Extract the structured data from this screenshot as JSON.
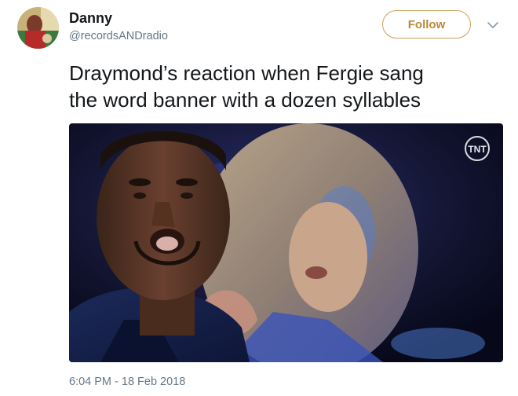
{
  "user": {
    "display_name": "Danny",
    "username": "@recordsANDradio"
  },
  "follow_button": {
    "label": "Follow"
  },
  "tweet": {
    "text": "Draymond’s reaction when Fergie sang\nthe word banner with a dozen syllables",
    "timestamp": "6:04 PM - 18 Feb 2018"
  },
  "media": {
    "watermark": "TNT"
  },
  "icons": {
    "menu": "chevron-down-icon"
  },
  "colors": {
    "follow_accent": "#c9a15a",
    "secondary_text": "#657786",
    "primary_text": "#14171a"
  }
}
